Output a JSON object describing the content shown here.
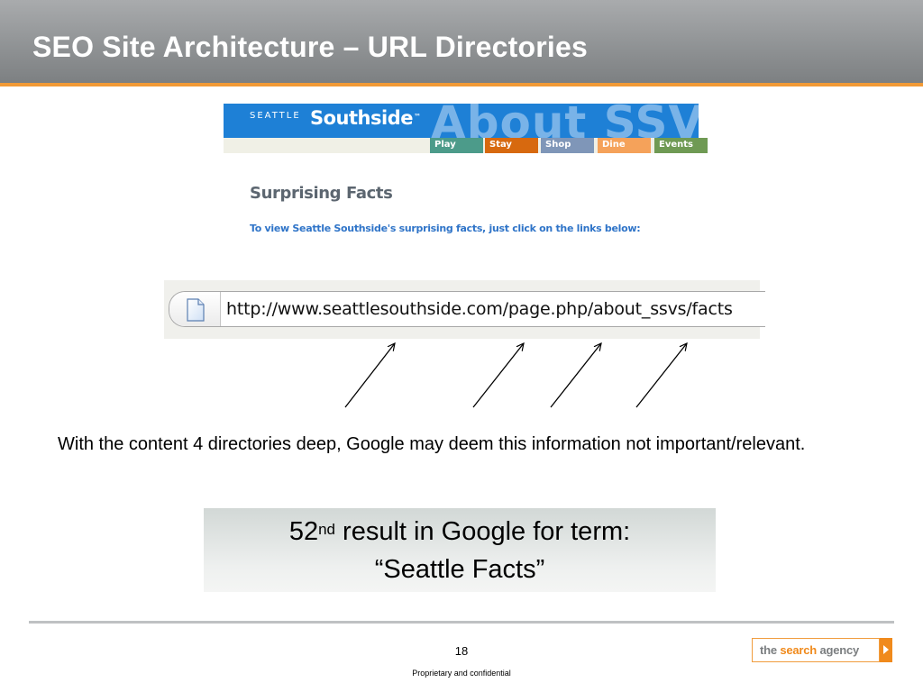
{
  "slide": {
    "title": "SEO Site Architecture – URL Directories",
    "body_text": "With the content 4 directories deep, Google may deem this information not important/relevant.",
    "result_number": "52",
    "result_suffix": "nd",
    "result_rest": " result in Google for term:",
    "result_term": "“Seattle Facts”",
    "page_number": "18",
    "footer_note": "Proprietary and confidential"
  },
  "website": {
    "brand_small": "SEATTLE",
    "brand_main": "Southside",
    "brand_tm": "™",
    "watermark": "About SSVS",
    "nav": [
      {
        "label": "Play",
        "color": "#4c9b8a"
      },
      {
        "label": "Stay",
        "color": "#d7690f"
      },
      {
        "label": "Shop",
        "color": "#7f96b8"
      },
      {
        "label": "Dine",
        "color": "#f5a25a"
      },
      {
        "label": "Events",
        "color": "#6f9a54"
      }
    ],
    "heading": "Surprising Facts",
    "subtext": "To view Seattle Southside's surprising facts, just click on the links below:"
  },
  "address_bar": {
    "url": "http://www.seattlesouthside.com/page.php/about_ssvs/facts",
    "icon": "page-icon"
  },
  "logo": {
    "the": "the ",
    "search": "search",
    "agency": " agency"
  },
  "colors": {
    "accent": "#f29a36",
    "header_gray": "#909395",
    "banner_blue": "#1e80d6"
  }
}
